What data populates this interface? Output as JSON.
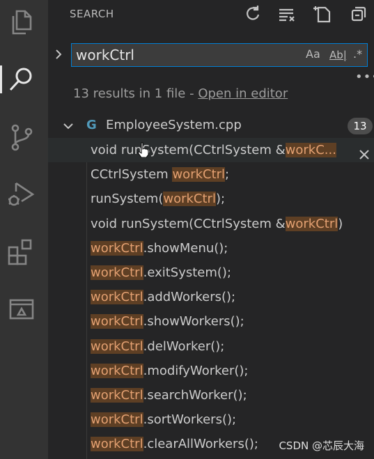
{
  "activity_bar": {
    "icons": [
      "explorer-icon",
      "search-icon",
      "source-control-icon",
      "run-debug-icon",
      "extensions-icon",
      "remote-explorer-icon"
    ]
  },
  "sidebar": {
    "title": "SEARCH",
    "header_actions": [
      "refresh-icon",
      "clear-results-icon",
      "new-search-editor-icon",
      "collapse-all-icon"
    ]
  },
  "search": {
    "query": "workCtrl",
    "match_case_label": "Aa",
    "whole_word_label": "Ab|",
    "regex_label": ".*"
  },
  "summary": {
    "text": "13 results in 1 file - ",
    "link": "Open in editor"
  },
  "file": {
    "icon_glyph": "G",
    "name": "EmployeeSystem.cpp",
    "count": "13"
  },
  "results": [
    {
      "pre": "void runSystem(CCtrlSystem &",
      "match": "workC...",
      "post": ""
    },
    {
      "pre": "CCtrlSystem ",
      "match": "workCtrl",
      "post": ";"
    },
    {
      "pre": "runSystem(",
      "match": "workCtrl",
      "post": ");"
    },
    {
      "pre": "void runSystem(CCtrlSystem &",
      "match": "workCtrl",
      "post": ")"
    },
    {
      "pre": "",
      "match": "workCtrl",
      "post": ".showMenu();"
    },
    {
      "pre": "",
      "match": "workCtrl",
      "post": ".exitSystem();"
    },
    {
      "pre": "",
      "match": "workCtrl",
      "post": ".addWorkers();"
    },
    {
      "pre": "",
      "match": "workCtrl",
      "post": ".showWorkers();"
    },
    {
      "pre": "",
      "match": "workCtrl",
      "post": ".delWorker();"
    },
    {
      "pre": "",
      "match": "workCtrl",
      "post": ".modifyWorker();"
    },
    {
      "pre": "",
      "match": "workCtrl",
      "post": ".searchWorker();"
    },
    {
      "pre": "",
      "match": "workCtrl",
      "post": ".sortWorkers();"
    },
    {
      "pre": "",
      "match": "workCtrl",
      "post": ".clearAllWorkers();"
    }
  ],
  "watermark": "CSDN @芯辰大海",
  "colors": {
    "accent_border": "#007fd4",
    "match_bg": "#5e3f24",
    "match_fg": "#e3a071"
  }
}
